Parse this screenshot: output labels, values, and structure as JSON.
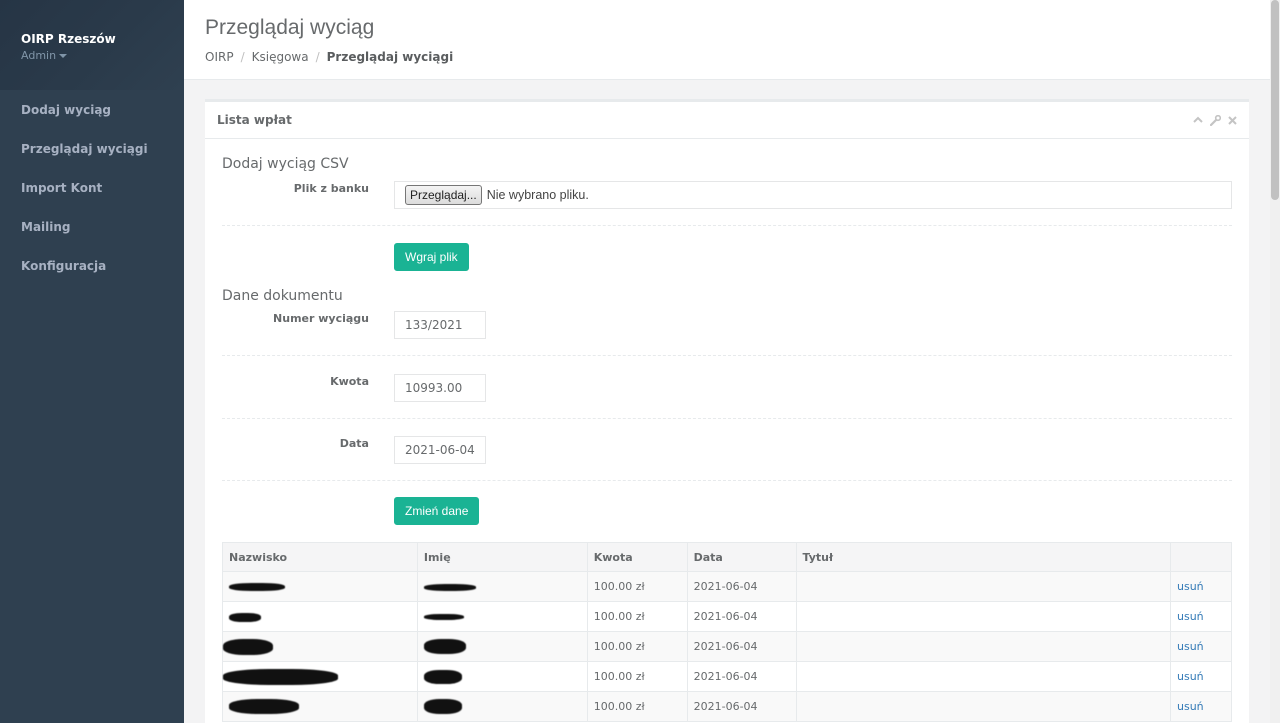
{
  "sidebar": {
    "org_name": "OIRP Rzeszów",
    "role": "Admin",
    "items": [
      {
        "label": "Dodaj wyciąg"
      },
      {
        "label": "Przeglądaj wyciągi"
      },
      {
        "label": "Import Kont"
      },
      {
        "label": "Mailing"
      },
      {
        "label": "Konfiguracja"
      }
    ]
  },
  "header": {
    "title": "Przeglądaj wyciąg",
    "breadcrumb": [
      "OIRP",
      "Księgowa",
      "Przeglądaj wyciągi"
    ]
  },
  "panel": {
    "title": "Lista wpłat",
    "icons": [
      "chevron-up-icon",
      "wrench-icon",
      "close-icon"
    ]
  },
  "upload": {
    "section_title": "Dodaj wyciąg CSV",
    "file_label": "Plik z banku",
    "browse_button": "Przeglądaj...",
    "no_file_text": "Nie wybrano pliku.",
    "submit_button": "Wgraj plik"
  },
  "document": {
    "section_title": "Dane dokumentu",
    "number_label": "Numer wyciągu",
    "number_value": "133/2021",
    "amount_label": "Kwota",
    "amount_value": "10993.00",
    "date_label": "Data",
    "date_value": "2021-06-04",
    "submit_button": "Zmień dane"
  },
  "table": {
    "columns": [
      "Nazwisko",
      "Imię",
      "Kwota",
      "Data",
      "Tytuł",
      ""
    ],
    "rows": [
      {
        "kwota": "100.00 zł",
        "data": "2021-06-04",
        "tytul": "",
        "action": "usuń"
      },
      {
        "kwota": "100.00 zł",
        "data": "2021-06-04",
        "tytul": "",
        "action": "usuń"
      },
      {
        "kwota": "100.00 zł",
        "data": "2021-06-04",
        "tytul": "",
        "action": "usuń"
      },
      {
        "kwota": "100.00 zł",
        "data": "2021-06-04",
        "tytul": "",
        "action": "usuń"
      },
      {
        "kwota": "100.00 zł",
        "data": "2021-06-04",
        "tytul": "",
        "action": "usuń"
      }
    ]
  },
  "colors": {
    "sidebar_bg": "#2f4050",
    "accent_green": "#1ab394",
    "link_blue": "#337ab7"
  }
}
